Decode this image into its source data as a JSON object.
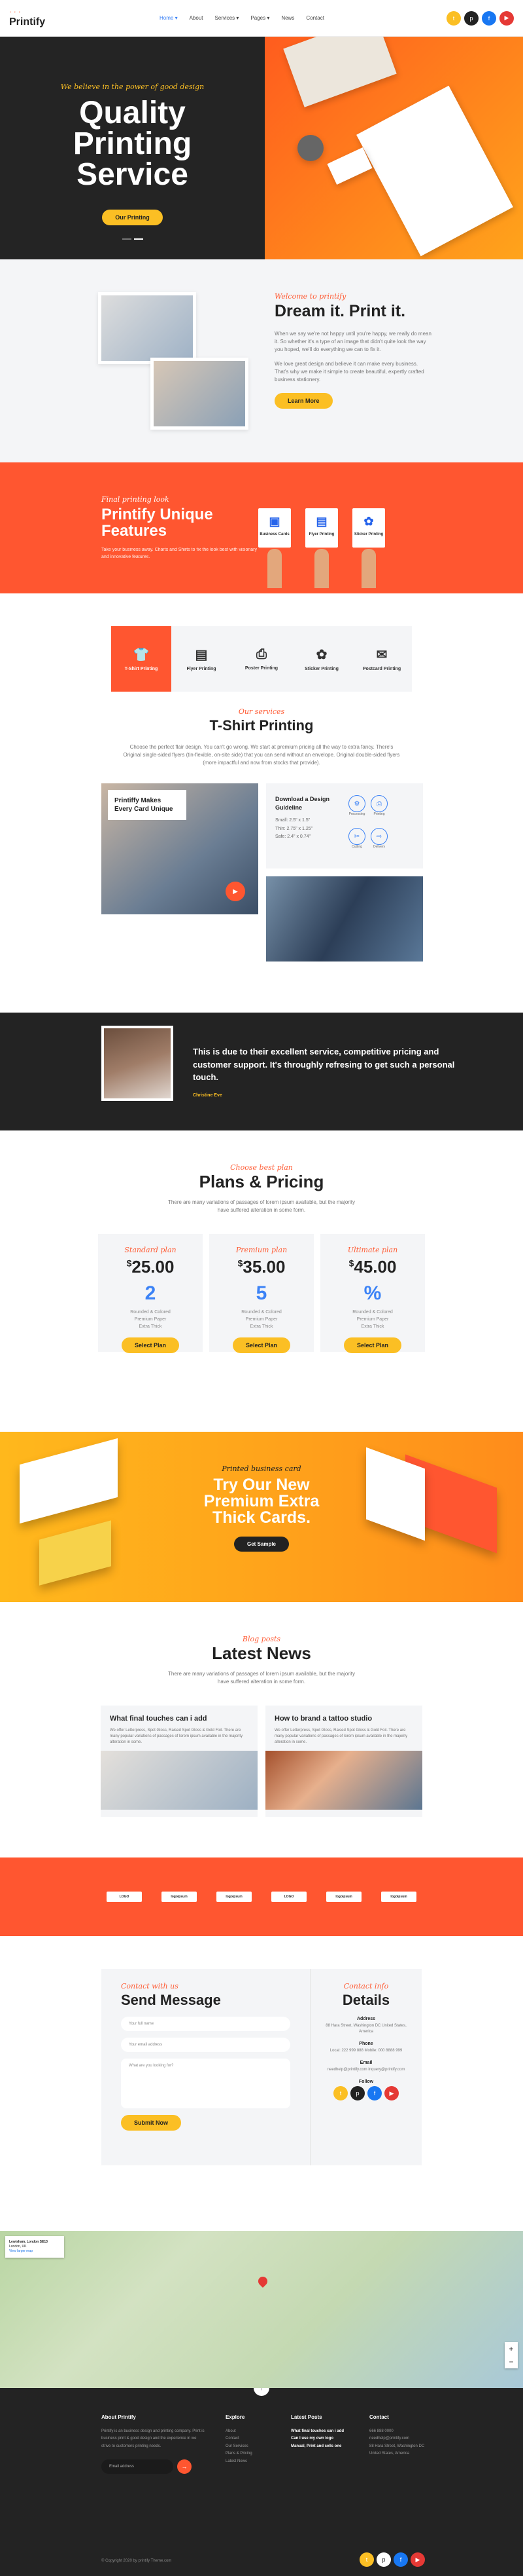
{
  "header": {
    "logo": "Printify",
    "logo_tag": "· · ·",
    "nav": [
      "Home ▾",
      "About",
      "Services ▾",
      "Pages ▾",
      "News",
      "Contact"
    ],
    "nav_active": 0
  },
  "hero": {
    "tagline": "We believe in the power of good design",
    "title_1": "Quality",
    "title_2": "Printing",
    "title_3": "Service",
    "button": "Our Printing"
  },
  "about": {
    "kicker": "Welcome to printify",
    "title": "Dream it. Print it.",
    "p1": "When we say we're not happy until you're happy, we really do mean it. So whether it's a type of an image that didn't quite look the way you hoped, we'll do everything we can to fix it.",
    "p2": "We love great design and believe it can make every business. That's why we make it simple to create beautiful, expertly crafted business stationery.",
    "button": "Learn More"
  },
  "features": {
    "kicker": "Final printing look",
    "title": "Printify Unique Features",
    "text": "Take your business away. Charts and Shirts to fix the look best with visionary and innovative features.",
    "cards": [
      "Business Cards",
      "Flyer Printing",
      "Sticker Printing"
    ]
  },
  "tshirt": {
    "tabs": [
      "T-Shirt Printing",
      "Flyer Printing",
      "Poster Printing",
      "Sticker Printing",
      "Postcard Printing"
    ],
    "kicker": "Our services",
    "title": "T-Shirt Printing",
    "text": "Choose the perfect flair design. You can't go wrong. We start at premium pricing all the way to extra fancy. There's Original single-sided flyers (tin-flexible, on-site side) that you can send without an envelope. Original double-sided flyers (more impactful and now from stocks that provide)."
  },
  "services": {
    "card_title": "Printiffy Makes Every Card Unique",
    "guide_title": "Download a Design Guideline",
    "sizes": [
      "Small: 2.5\" x 1.5\"",
      "Thin: 2.75\" x 1.25\"",
      "Safe: 2.4\" x 0.74\""
    ],
    "icons": [
      "Processing",
      "Printing",
      "Cutting",
      "Delivery"
    ]
  },
  "testimonial": {
    "quote": "This is due to their excellent service, competitive pricing and customer support. It's throughly refresing to get such a personal touch.",
    "author": "Christine Eve"
  },
  "pricing": {
    "kicker": "Choose best plan",
    "title": "Plans & Pricing",
    "text": "There are many variations of passages of lorem ipsum available, but the majority have suffered alteration in some form.",
    "plans": [
      {
        "tag": "Standard plan",
        "price": "25.00",
        "num": "2",
        "feat": "Rounded & Colored\nPremium Paper\nExtra Thick",
        "button": "Select Plan"
      },
      {
        "tag": "Premium plan",
        "price": "35.00",
        "num": "5",
        "feat": "Rounded & Colored\nPremium Paper\nExtra Thick",
        "button": "Select Plan"
      },
      {
        "tag": "Ultimate plan",
        "price": "45.00",
        "num": "%",
        "feat": "Rounded & Colored\nPremium Paper\nExtra Thick",
        "button": "Select Plan"
      }
    ]
  },
  "promo": {
    "kicker": "Printed business card",
    "title_1": "Try Our New",
    "title_2": "Premium Extra",
    "title_3": "Thick Cards.",
    "button": "Get Sample"
  },
  "news": {
    "kicker": "Blog posts",
    "title": "Latest News",
    "text": "There are many variations of passages of lorem ipsum available, but the majority have suffered alteration in some form.",
    "posts": [
      {
        "title": "What final touches can i add",
        "text": "We offer Letterpress, Spot Gloss, Raised Spot Gloss & Gold Foil. There are many popular variations of passages of lorem ipsum available in the majority alteration in some."
      },
      {
        "title": "How to brand a tattoo studio",
        "text": "We offer Letterpress, Spot Gloss, Raised Spot Gloss & Gold Foil. There are many popular variations of passages of lorem ipsum available in the majority alteration in some."
      }
    ]
  },
  "partners": [
    "LOGO",
    "logoipsum",
    "logoipsum",
    "LOGO",
    "logoipsum",
    "logoipsum"
  ],
  "contact": {
    "kicker": "Contact with us",
    "title": "Send Message",
    "name_ph": "Your full name",
    "email_ph": "Your email address",
    "msg_ph": "What are you looking for?",
    "button": "Submit Now",
    "info_kicker": "Contact info",
    "info_title": "Details",
    "address_h": "Address",
    "address": "88 Hara Street, Washington DC United States, America",
    "phone_h": "Phone",
    "phone": "Local: 222 999 888 Mobile: 000 8888 999",
    "email_h": "Email",
    "email": "needhelp@printify.com inquery@printify.com",
    "follow_h": "Follow"
  },
  "map": {
    "card_title": "Lewisham, London SE13",
    "card_text": "London, UK",
    "link": "View larger map"
  },
  "footer": {
    "about_h": "About Printify",
    "about": "Printify is an business design and printing company. Print is business print & good design and the experience in we strive to customers printing needs.",
    "email_ph": "Email address",
    "explore_h": "Explore",
    "explore": [
      "About",
      "Contact",
      "Our Services",
      "Plans & Pricing",
      "Latest News"
    ],
    "posts_h": "Latest Posts",
    "posts": [
      "What final touches can i add",
      "Can I use my own logo",
      "Manual, Print and sells one"
    ],
    "contact_h": "Contact",
    "contact": [
      "666 888 0000",
      "needhelp@printify.com",
      "88 Hara Street, Washington DC United States, America"
    ],
    "copy": "© Copyright 2020 by printify Theme.com"
  },
  "colors": {
    "accent": "#ff5630",
    "yellow": "#fbbf24",
    "dark": "#232323",
    "blue": "#3b82f6"
  }
}
